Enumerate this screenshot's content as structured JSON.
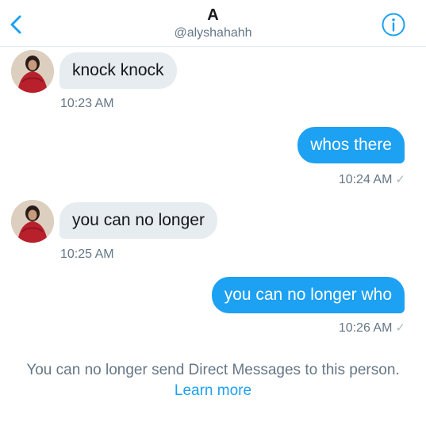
{
  "header": {
    "title": "A",
    "handle": "@alyshahahh",
    "back_icon": "chevron-left-icon",
    "info_icon": "info-circle-icon",
    "accent": "#1da1f2"
  },
  "messages": [
    {
      "direction": "incoming",
      "text": "knock knock",
      "time": "10:23 AM"
    },
    {
      "direction": "outgoing",
      "text": "whos there",
      "time": "10:24 AM",
      "status": "✓"
    },
    {
      "direction": "incoming",
      "text": "you can no longer",
      "time": "10:25 AM"
    },
    {
      "direction": "outgoing",
      "text": "you can no longer who",
      "time": "10:26 AM",
      "status": "✓"
    }
  ],
  "notice": {
    "text": "You can no longer send Direct Messages to this person.",
    "link": "Learn more"
  }
}
